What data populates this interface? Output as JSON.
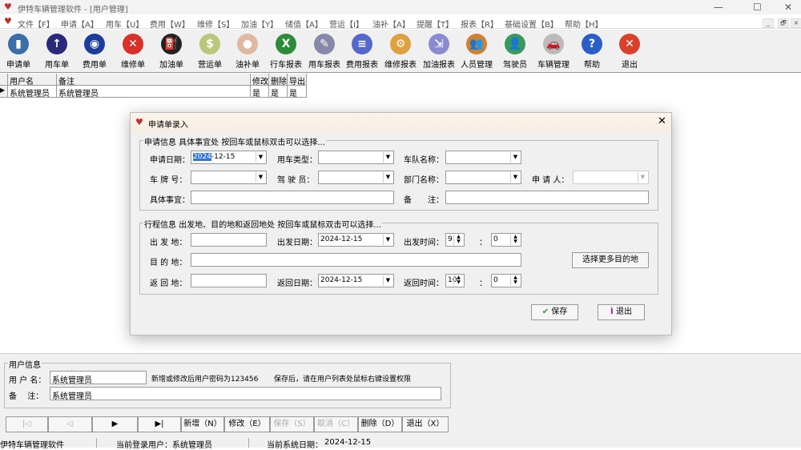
{
  "window": {
    "title": "伊特车辆管理软件 - [用户管理]",
    "minimize": "—",
    "maximize": "☐",
    "close": "✕"
  },
  "menu": [
    "文件【F】",
    "申请【A】",
    "用车【U】",
    "费用【W】",
    "维修【S】",
    "加油【Y】",
    "储值【A】",
    "营运【I】",
    "油补【A】",
    "提醒【T】",
    "报表【R】",
    "基础设置【B】",
    "帮助【H】"
  ],
  "mdi_controls": [
    "_",
    "🗗",
    "×"
  ],
  "toolbar": [
    {
      "label": "申请单",
      "icon": "door-icon",
      "color": "#3a6fa8",
      "glyph": "▮"
    },
    {
      "label": "用车单",
      "icon": "arrow-up-icon",
      "color": "#2a2a7a",
      "glyph": "↑"
    },
    {
      "label": "费用单",
      "icon": "car-sign-icon",
      "color": "#1e3c9a",
      "glyph": "◉"
    },
    {
      "label": "维修单",
      "icon": "warning-triangle-icon",
      "color": "#d9302a",
      "glyph": "✕"
    },
    {
      "label": "加油单",
      "icon": "fuel-pump-icon",
      "color": "#222",
      "glyph": "⛽"
    },
    {
      "label": "营运单",
      "icon": "money-icon",
      "color": "#b9c77a",
      "glyph": "$"
    },
    {
      "label": "油补单",
      "icon": "piggy-bank-icon",
      "color": "#e0b8a0",
      "glyph": "●"
    },
    {
      "label": "行车报表",
      "icon": "excel-icon",
      "color": "#2e8b3a",
      "glyph": "X"
    },
    {
      "label": "用车报表",
      "icon": "scroll-pen-icon",
      "color": "#8888aa",
      "glyph": "✎"
    },
    {
      "label": "费用报表",
      "icon": "document-pen-icon",
      "color": "#5566cc",
      "glyph": "≡"
    },
    {
      "label": "维修报表",
      "icon": "tools-icon",
      "color": "#e0a040",
      "glyph": "⚙"
    },
    {
      "label": "加油报表",
      "icon": "fuel-report-icon",
      "color": "#8a8ad0",
      "glyph": "⇲"
    },
    {
      "label": "人员管理",
      "icon": "people-icon",
      "color": "#d08030",
      "glyph": "👥"
    },
    {
      "label": "驾驶员",
      "icon": "drivers-icon",
      "color": "#3a9a5a",
      "glyph": "👤"
    },
    {
      "label": "车辆管理",
      "icon": "car-icon",
      "color": "#bbb",
      "glyph": "🚗"
    },
    {
      "label": "帮助",
      "icon": "help-icon",
      "color": "#2a5fc8",
      "glyph": "?"
    },
    {
      "label": "退出",
      "icon": "exit-icon",
      "color": "#d9402a",
      "glyph": "✕"
    }
  ],
  "grid": {
    "headers": [
      "用户名",
      "备注",
      "修改",
      "删除",
      "导出"
    ],
    "rows": [
      [
        "系统管理员",
        "系统管理员",
        "是",
        "是",
        "是"
      ]
    ]
  },
  "dialog": {
    "title": "申请单录入",
    "group1": {
      "title": "申请信息 具体事宜处 按回车或鼠标双击可以选择...",
      "apply_date_label": "申请日期：",
      "apply_date_sel": "2024",
      "apply_date_rest": "-12-15",
      "car_type_label": "用车类型：",
      "team_label": "车队名称：",
      "plate_label": "车 牌 号：",
      "driver_label": "驾 驶 员：",
      "dept_label": "部门名称：",
      "applicant_label": "申 请 人：",
      "matter_label": "具体事宜：",
      "remark_label": "备　　注："
    },
    "group2": {
      "title": "行程信息 出发地、目的地和返回地处 按回车或鼠标双击可以选择...",
      "from_label": "出 发 地：",
      "depart_date_label": "出发日期：",
      "depart_date": "2024-12-15",
      "depart_time_label": "出发时间：",
      "depart_hour": "9",
      "depart_min": "0",
      "dest_label": "目 的 地：",
      "more_dest_button": "选择更多目的地",
      "return_label": "返 回 地：",
      "return_date_label": "返回日期：",
      "return_date": "2024-12-15",
      "return_time_label": "返回时间：",
      "return_hour": "10",
      "return_min": "0",
      "colon": "："
    },
    "save_button": "保存",
    "exit_button": "退出"
  },
  "user_info": {
    "title": "用户信息",
    "username_label": "用 户 名：",
    "username": "系统管理员",
    "hint1": "新增或修改后用户密码为123456",
    "hint2": "保存后，请在用户列表处鼠标右键设置权限",
    "remark_label": "备　 注：",
    "remark": "系统管理员"
  },
  "nav": {
    "first": "|◁",
    "prev": "◁",
    "next": "▶",
    "last": "▶|",
    "add": "新增（N）",
    "edit": "修改（E）",
    "save": "保存（S）",
    "cancel": "取消（C）",
    "delete": "删除（D）",
    "exit": "退出（X）"
  },
  "status": {
    "app": "伊特车辆管理软件",
    "user_label": "当前登录用户：",
    "user": "系统管理员",
    "date_label": "当前系统日期：",
    "date": "2024-12-15"
  }
}
